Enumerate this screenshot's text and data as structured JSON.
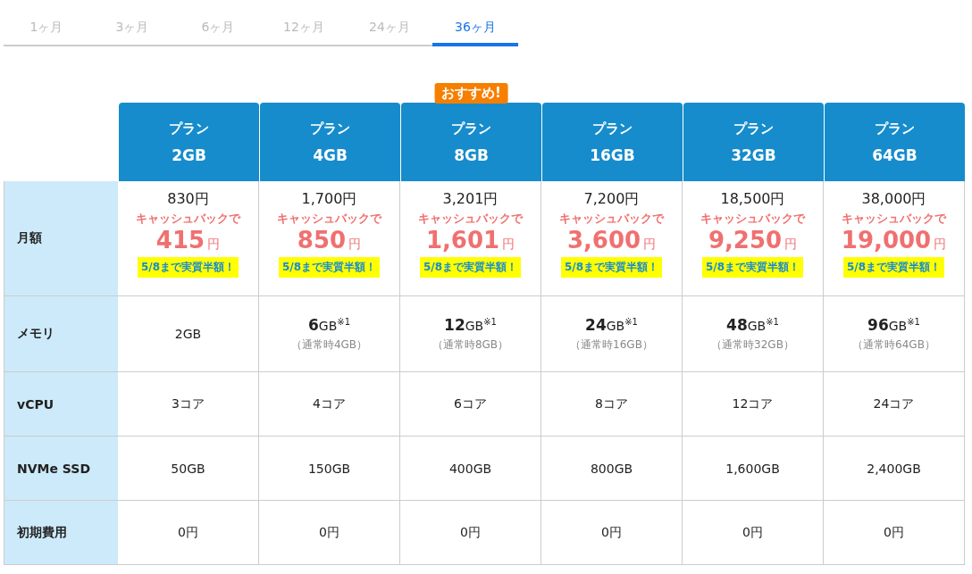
{
  "tabs": [
    {
      "label": "1ヶ月",
      "selected": false
    },
    {
      "label": "3ヶ月",
      "selected": false
    },
    {
      "label": "6ヶ月",
      "selected": false
    },
    {
      "label": "12ヶ月",
      "selected": false
    },
    {
      "label": "24ヶ月",
      "selected": false
    },
    {
      "label": "36ヶ月",
      "selected": true
    }
  ],
  "plans": [
    {
      "label": "プラン",
      "size": "2GB"
    },
    {
      "label": "プラン",
      "size": "4GB"
    },
    {
      "label": "プラン",
      "size": "8GB",
      "badge": "おすすめ!"
    },
    {
      "label": "プラン",
      "size": "16GB"
    },
    {
      "label": "プラン",
      "size": "32GB"
    },
    {
      "label": "プラン",
      "size": "64GB"
    }
  ],
  "rows": [
    {
      "kind": "price",
      "label": "月額",
      "cells": [
        {
          "price": "830円",
          "cashback_label": "キャッシュバックで",
          "cashback_amount": "415",
          "cashback_unit": "円",
          "note": "5/8まで実質半額！"
        },
        {
          "price": "1,700円",
          "cashback_label": "キャッシュバックで",
          "cashback_amount": "850",
          "cashback_unit": "円",
          "note": "5/8まで実質半額！"
        },
        {
          "price": "3,201円",
          "cashback_label": "キャッシュバックで",
          "cashback_amount": "1,601",
          "cashback_unit": "円",
          "note": "5/8まで実質半額！"
        },
        {
          "price": "7,200円",
          "cashback_label": "キャッシュバックで",
          "cashback_amount": "3,600",
          "cashback_unit": "円",
          "note": "5/8まで実質半額！"
        },
        {
          "price": "18,500円",
          "cashback_label": "キャッシュバックで",
          "cashback_amount": "9,250",
          "cashback_unit": "円",
          "note": "5/8まで実質半額！"
        },
        {
          "price": "38,000円",
          "cashback_label": "キャッシュバックで",
          "cashback_amount": "19,000",
          "cashback_unit": "円",
          "note": "5/8まで実質半額！"
        }
      ]
    },
    {
      "kind": "spec",
      "label": "メモリ",
      "cells": [
        {
          "value": "2GB"
        },
        {
          "value": "**6**GB$^{※1}$",
          "sub": "（通常時4GB）"
        },
        {
          "value": "**12**GB$^{※1}$",
          "sub": "（通常時8GB）"
        },
        {
          "value": "**24**GB$^{※1}$",
          "sub": "（通常時16GB）"
        },
        {
          "value": "**48**GB$^{※1}$",
          "sub": "（通常時32GB）"
        },
        {
          "value": "**96**GB$^{※1}$",
          "sub": "（通常時64GB）"
        }
      ]
    },
    {
      "kind": "spec",
      "label": "vCPU",
      "cells": [
        {
          "value": "3コア"
        },
        {
          "value": "4コア"
        },
        {
          "value": "6コア"
        },
        {
          "value": "8コア"
        },
        {
          "value": "12コア"
        },
        {
          "value": "24コア"
        }
      ]
    },
    {
      "kind": "spec",
      "label": "NVMe SSD",
      "cells": [
        {
          "value": "50GB"
        },
        {
          "value": "150GB"
        },
        {
          "value": "400GB"
        },
        {
          "value": "800GB"
        },
        {
          "value": "1,600GB"
        },
        {
          "value": "2,400GB"
        }
      ]
    },
    {
      "kind": "spec",
      "label": "初期費用",
      "cells": [
        {
          "value": "0円"
        },
        {
          "value": "0円"
        },
        {
          "value": "0円"
        },
        {
          "value": "0円"
        },
        {
          "value": "0円"
        },
        {
          "value": "0円"
        }
      ]
    }
  ]
}
